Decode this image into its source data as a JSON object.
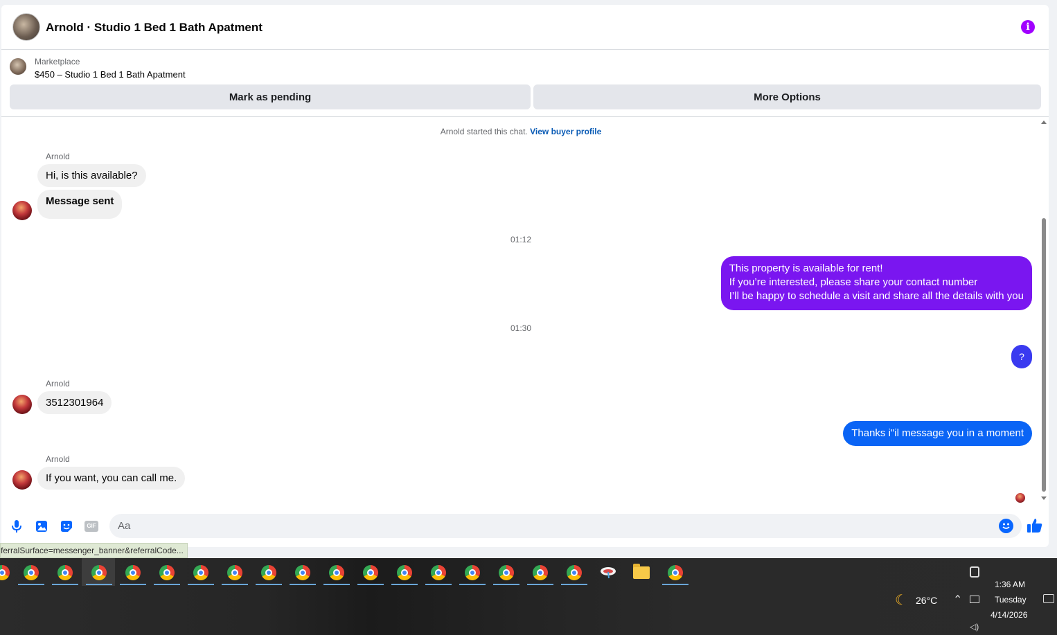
{
  "header": {
    "title": "Arnold · Studio 1 Bed 1 Bath Apatment",
    "info_icon": "info-icon"
  },
  "listing": {
    "source": "Marketplace",
    "title": "$450 – Studio 1 Bed 1 Bath Apatment",
    "mark_pending_label": "Mark as pending",
    "more_options_label": "More Options"
  },
  "chat": {
    "system_text": "Arnold started this chat.",
    "system_link": "View buyer profile",
    "sender_name": "Arnold",
    "messages": [
      {
        "text": "Hi, is this available?"
      },
      {
        "text": "Message sent"
      },
      {
        "timestamp": "01:12"
      },
      {
        "lines": [
          "This property is available for rent!",
          "If you’re interested, please share your contact number",
          "I’ll be happy to schedule a visit and share all the details with you"
        ]
      },
      {
        "timestamp": "01:30"
      },
      {
        "text": "?"
      },
      {
        "text": "3512301964"
      },
      {
        "text": "Thanks i\"il message you in a moment"
      },
      {
        "text": "If you want, you can call me."
      }
    ]
  },
  "composer": {
    "placeholder": "Aa",
    "icons": [
      "microphone-icon",
      "photo-icon",
      "sticker-icon",
      "gif-icon",
      "emoji-icon",
      "thumbs-up-icon"
    ],
    "gif_label": "GIF"
  },
  "status_bar": {
    "url": "ferralSurface=messenger_banner&referralCode..."
  },
  "taskbar": {
    "weather": "26°C",
    "time": "1:36 AM",
    "day": "Tuesday",
    "date": "4/14/2026"
  },
  "colors": {
    "accent": "#0866ff",
    "outgoing_violet": "#7a16f0",
    "outgoing_blue": "#0a64f5",
    "info": "#a100ff"
  }
}
